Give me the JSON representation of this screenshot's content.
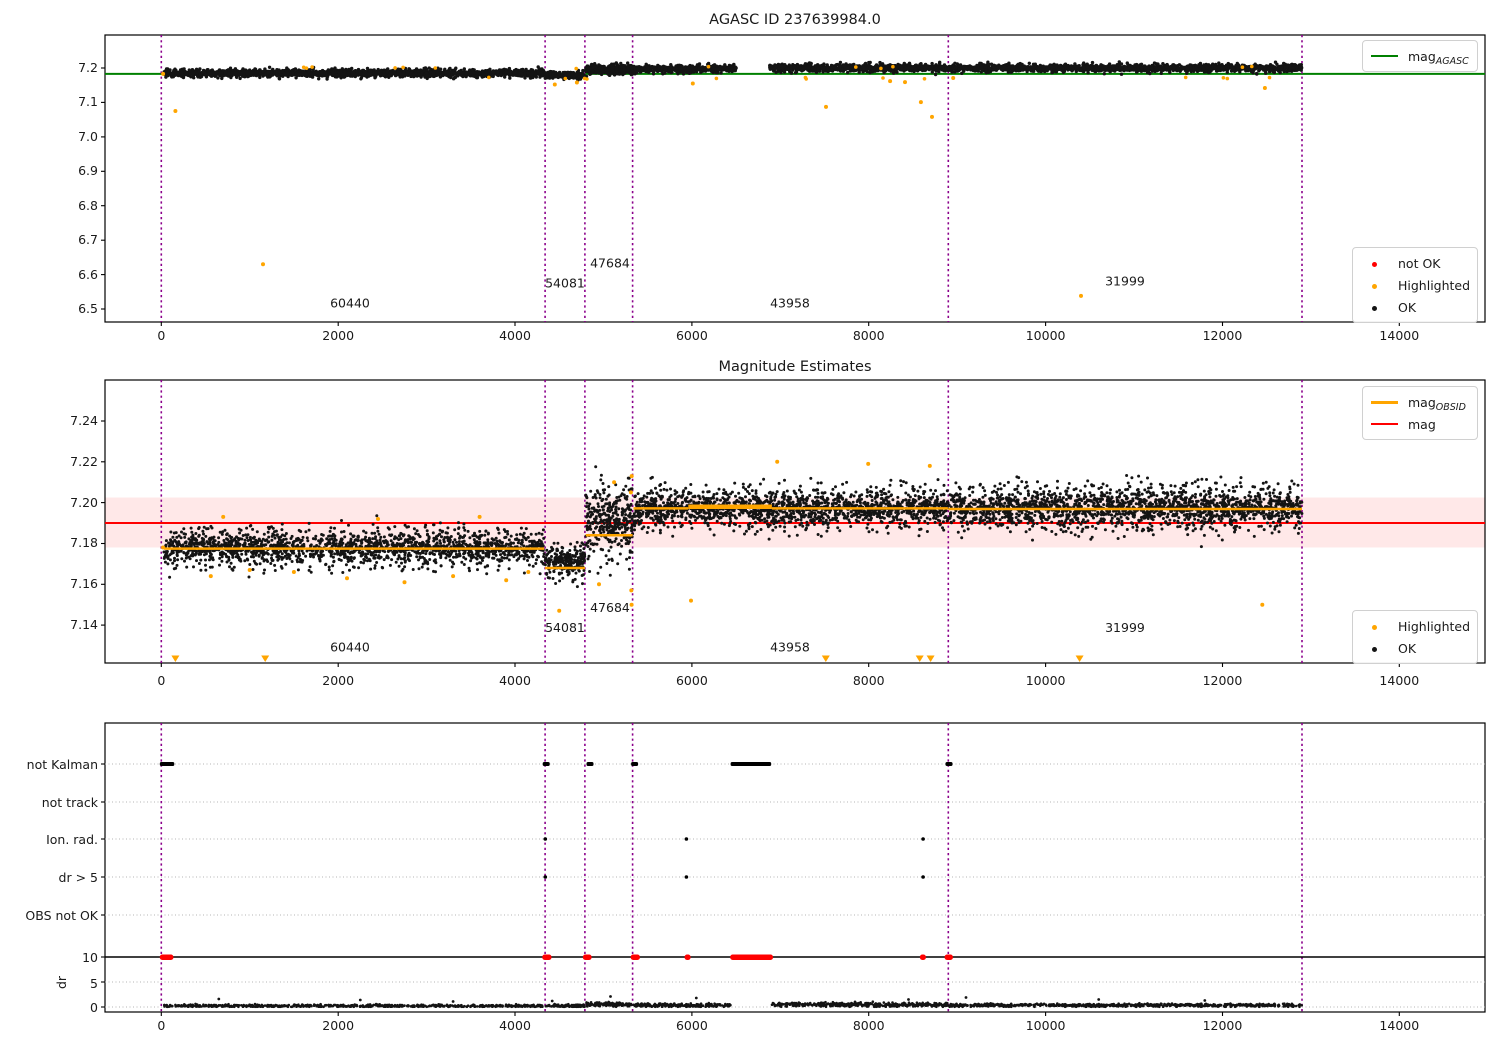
{
  "colors": {
    "green": "#008000",
    "orange": "#ffa500",
    "red": "#ff0000",
    "purple": "#8b008b",
    "point_black": "#141414",
    "pink_band": "rgba(255,0,0,0.09)",
    "grid": "#b5b5b5"
  },
  "titles": {
    "top": "AGASC ID 237639984.0",
    "middle": "Magnitude Estimates"
  },
  "legends": {
    "top_line": {
      "main": "mag",
      "sub": "AGASC"
    },
    "top_points": [
      {
        "color": "#ff0000",
        "label": "not OK"
      },
      {
        "color": "#ffa500",
        "label": "Highlighted"
      },
      {
        "color": "#141414",
        "label": "OK"
      }
    ],
    "mid_lines": [
      {
        "color": "#ffa500",
        "main": "mag",
        "sub": "OBSID"
      },
      {
        "color": "#ff0000",
        "main": "mag",
        "sub": ""
      }
    ],
    "mid_points": [
      {
        "color": "#ffa500",
        "label": "Highlighted"
      },
      {
        "color": "#141414",
        "label": "OK"
      }
    ]
  },
  "chart_data": [
    {
      "type": "scatter",
      "title": "AGASC ID 237639984.0",
      "xlim": [
        -640,
        14975
      ],
      "ylim": [
        6.46,
        7.295
      ],
      "xtick_labels": [
        "0",
        "2000",
        "4000",
        "6000",
        "8000",
        "10000",
        "12000",
        "14000"
      ],
      "xtick_values": [
        0,
        2000,
        4000,
        6000,
        8000,
        10000,
        12000,
        14000
      ],
      "ytick_labels": [
        "7.2",
        "7.1",
        "7.0",
        "6.9",
        "6.8",
        "6.7",
        "6.6",
        "6.5"
      ],
      "ytick_values": [
        7.2,
        7.1,
        7.0,
        6.9,
        6.8,
        6.7,
        6.6,
        6.5
      ],
      "agasc_mag_line": 7.183,
      "vlines": [
        0,
        4340,
        4790,
        5330,
        8900,
        12900
      ],
      "ok_bands": [
        {
          "x0": 30,
          "x1": 4330,
          "center": 7.185,
          "spread": 0.013,
          "n": 1250
        },
        {
          "x0": 4340,
          "x1": 4790,
          "center": 7.179,
          "spread": 0.012,
          "n": 150
        },
        {
          "x0": 4800,
          "x1": 5330,
          "center": 7.195,
          "spread": 0.016,
          "n": 230
        },
        {
          "x0": 5340,
          "x1": 6500,
          "center": 7.197,
          "spread": 0.012,
          "n": 340
        },
        {
          "x0": 6880,
          "x1": 12900,
          "center": 7.2,
          "spread": 0.013,
          "n": 1650
        }
      ],
      "highlighted_points": [
        [
          20,
          7.183
        ],
        [
          160,
          7.075
        ],
        [
          1150,
          6.63
        ],
        [
          4450,
          7.152
        ],
        [
          4700,
          7.158
        ],
        [
          6010,
          7.155
        ],
        [
          7517,
          7.087
        ],
        [
          8241,
          7.162
        ],
        [
          8410,
          7.159
        ],
        [
          8590,
          7.101
        ],
        [
          8715,
          7.058
        ],
        [
          8955,
          7.171
        ],
        [
          10400,
          6.538
        ],
        [
          12480,
          7.142
        ]
      ],
      "highlighted_sprinkle": {
        "x0": 150,
        "x1": 12800,
        "n": 26,
        "center": 7.186,
        "offset": 0.016
      },
      "annotations": [
        {
          "text": "60440",
          "x": 2134,
          "y": 6.505
        },
        {
          "text": "54081",
          "x": 4565,
          "y": 6.563
        },
        {
          "text": "47684",
          "x": 5074,
          "y": 6.621
        },
        {
          "text": "43958",
          "x": 7110,
          "y": 6.505
        },
        {
          "text": "31999",
          "x": 10898,
          "y": 6.568
        }
      ]
    },
    {
      "type": "scatter",
      "title": "Magnitude Estimates",
      "xlim": [
        -640,
        14975
      ],
      "ylim": [
        7.121,
        7.26
      ],
      "xtick_labels": [
        "0",
        "2000",
        "4000",
        "6000",
        "8000",
        "10000",
        "12000",
        "14000"
      ],
      "xtick_values": [
        0,
        2000,
        4000,
        6000,
        8000,
        10000,
        12000,
        14000
      ],
      "ytick_labels": [
        "7.24",
        "7.22",
        "7.20",
        "7.18",
        "7.16",
        "7.14"
      ],
      "ytick_values": [
        7.24,
        7.22,
        7.2,
        7.18,
        7.16,
        7.14
      ],
      "mag_line": 7.19,
      "mag_band": [
        7.178,
        7.2025
      ],
      "vlines": [
        0,
        4340,
        4790,
        5330,
        8900,
        12900
      ],
      "ok_bands": [
        {
          "x0": 30,
          "x1": 4330,
          "center": 7.178,
          "spread": 0.011,
          "n": 1250
        },
        {
          "x0": 4340,
          "x1": 4790,
          "center": 7.171,
          "spread": 0.01,
          "n": 170
        },
        {
          "x0": 4800,
          "x1": 5330,
          "center": 7.19,
          "spread": 0.022,
          "n": 230
        },
        {
          "x0": 5340,
          "x1": 8900,
          "center": 7.197,
          "spread": 0.012,
          "n": 1150
        },
        {
          "x0": 8900,
          "x1": 12900,
          "center": 7.1975,
          "spread": 0.013,
          "n": 1300
        }
      ],
      "obsid_segments": [
        {
          "x0": 30,
          "x1": 4330,
          "mag": 7.1775,
          "lw": 2.5
        },
        {
          "x0": 4340,
          "x1": 4790,
          "mag": 7.168,
          "lw": 2.5
        },
        {
          "x0": 4800,
          "x1": 5330,
          "mag": 7.184,
          "lw": 2.5
        },
        {
          "x0": 5340,
          "x1": 5960,
          "mag": 7.1972,
          "lw": 2.5
        },
        {
          "x0": 5960,
          "x1": 6905,
          "mag": 7.198,
          "lw": 4.5
        },
        {
          "x0": 6905,
          "x1": 8895,
          "mag": 7.1972,
          "lw": 2.5
        },
        {
          "x0": 8900,
          "x1": 12900,
          "mag": 7.1969,
          "lw": 2.5
        }
      ],
      "highlighted_points": [
        [
          20,
          7.178
        ],
        [
          4500,
          7.147
        ],
        [
          5990,
          7.152
        ],
        [
          12450,
          7.15
        ],
        [
          5310,
          7.205
        ],
        [
          5320,
          7.213
        ],
        [
          5315,
          7.157
        ],
        [
          5318,
          7.15
        ],
        [
          5120,
          7.21
        ],
        [
          4950,
          7.16
        ],
        [
          6965,
          7.22
        ],
        [
          7994,
          7.219
        ],
        [
          8690,
          7.218
        ],
        [
          700,
          7.193
        ],
        [
          2450,
          7.192
        ],
        [
          3600,
          7.193
        ],
        [
          560,
          7.164
        ],
        [
          1000,
          7.167
        ],
        [
          1500,
          7.166
        ],
        [
          2100,
          7.163
        ],
        [
          2750,
          7.161
        ],
        [
          3300,
          7.164
        ],
        [
          3900,
          7.162
        ],
        [
          4150,
          7.166
        ]
      ],
      "clipped_markers": [
        160,
        1175,
        7514,
        8576,
        8700,
        10384
      ],
      "annotations": [
        {
          "text": "60440",
          "x": 2134,
          "y": 7.127
        },
        {
          "text": "54081",
          "x": 4565,
          "y": 7.1365
        },
        {
          "text": "47684",
          "x": 5074,
          "y": 7.1465
        },
        {
          "text": "43958",
          "x": 7110,
          "y": 7.127
        },
        {
          "text": "31999",
          "x": 10898,
          "y": 7.1365
        }
      ]
    },
    {
      "type": "scatter",
      "rows": [
        "not Kalman",
        "not track",
        "Ion. rad.",
        "dr > 5",
        "OBS not OK"
      ],
      "ylabel": "dr",
      "dr_tick_labels": [
        "10",
        "5",
        "0"
      ],
      "dr_tick_values": [
        10,
        5,
        0
      ],
      "xtick_labels": [
        "0",
        "2000",
        "4000",
        "6000",
        "8000",
        "10000",
        "12000",
        "14000"
      ],
      "xtick_values": [
        0,
        2000,
        4000,
        6000,
        8000,
        10000,
        12000,
        14000
      ],
      "vlines": [
        0,
        4340,
        4790,
        5330,
        8900,
        12900
      ],
      "dr_hline": 10,
      "flag_segments": {
        "not Kalman": [
          [
            0,
            130
          ],
          [
            4330,
            4375
          ],
          [
            4825,
            4870
          ],
          [
            5330,
            5375
          ],
          [
            6455,
            6880
          ],
          [
            8885,
            8930
          ]
        ],
        "not track": [],
        "Ion. rad.": [
          [
            4332,
            4352
          ],
          [
            5928,
            5948
          ],
          [
            8605,
            8625
          ]
        ],
        "dr > 5": [
          [
            4332,
            4352
          ],
          [
            5928,
            5948
          ],
          [
            8605,
            8625
          ]
        ],
        "OBS not OK": []
      },
      "dr_red_segments": [
        [
          0,
          120
        ],
        [
          4325,
          4395
        ],
        [
          4785,
          4850
        ],
        [
          5325,
          5395
        ],
        [
          5935,
          5965
        ],
        [
          6450,
          6900
        ],
        [
          8595,
          8625
        ],
        [
          8875,
          8935
        ]
      ],
      "dr_bands": [
        {
          "x0": 30,
          "x1": 4330,
          "center": 0.22,
          "spread": 0.3,
          "n": 650
        },
        {
          "x0": 4340,
          "x1": 4790,
          "center": 0.25,
          "spread": 0.32,
          "n": 90
        },
        {
          "x0": 4800,
          "x1": 5330,
          "center": 0.5,
          "spread": 0.5,
          "n": 120
        },
        {
          "x0": 5340,
          "x1": 6450,
          "center": 0.35,
          "spread": 0.4,
          "n": 220
        },
        {
          "x0": 6900,
          "x1": 8900,
          "center": 0.45,
          "spread": 0.45,
          "n": 400
        },
        {
          "x0": 8900,
          "x1": 12900,
          "center": 0.35,
          "spread": 0.35,
          "n": 700
        }
      ],
      "dr_spikes": [
        [
          650,
          1.6
        ],
        [
          2250,
          1.4
        ],
        [
          3300,
          1.1
        ],
        [
          4420,
          1.2
        ],
        [
          5080,
          2.1
        ],
        [
          6050,
          1.8
        ],
        [
          8450,
          1.5
        ],
        [
          9100,
          1.9
        ],
        [
          10600,
          1.5
        ],
        [
          11800,
          1.3
        ]
      ]
    }
  ]
}
